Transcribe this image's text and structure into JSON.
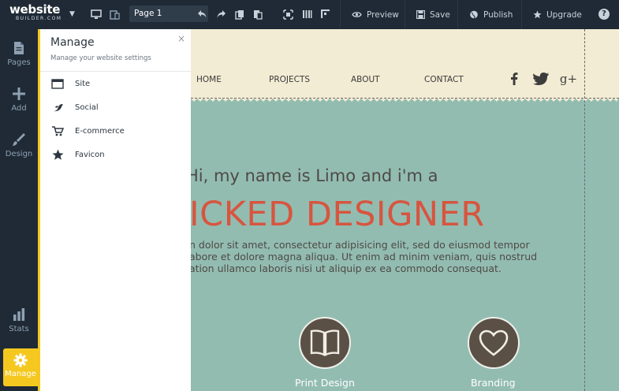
{
  "topbar": {
    "logo_main": "website",
    "logo_sub": "BUILDER.COM",
    "page_select": "Page 1",
    "preview_label": "Preview",
    "save_label": "Save",
    "publish_label": "Publish",
    "upgrade_label": "Upgrade",
    "help_label": "?"
  },
  "sidebar": {
    "items": [
      {
        "label": "Pages",
        "icon": "pages-icon"
      },
      {
        "label": "Add",
        "icon": "plus-icon"
      },
      {
        "label": "Design",
        "icon": "brush-icon"
      },
      {
        "label": "Stats",
        "icon": "stats-icon"
      }
    ],
    "active": {
      "label": "Manage",
      "icon": "gear-icon"
    },
    "accent_color": "#f5c81f"
  },
  "panel": {
    "title": "Manage",
    "subtitle": "Manage your website settings",
    "close": "×",
    "items": [
      {
        "label": "Site",
        "icon": "window-icon"
      },
      {
        "label": "Social",
        "icon": "bird-icon"
      },
      {
        "label": "E-commerce",
        "icon": "cart-icon"
      },
      {
        "label": "Favicon",
        "icon": "star-icon"
      }
    ]
  },
  "site": {
    "nav": [
      "HOME",
      "PROJECTS",
      "ABOUT",
      "CONTACT"
    ],
    "social": [
      {
        "label": "f",
        "icon": "facebook-icon"
      },
      {
        "label": "",
        "icon": "twitter-icon"
      },
      {
        "label": "g+",
        "icon": "google-plus-icon"
      }
    ],
    "hero_intro": "Hi, my name is Limo and i'm a",
    "hero_title": "ICKED DESIGNER",
    "hero_body": [
      "n dolor sit amet, consectetur adipisicing elit, sed do eiusmod tempor",
      "abore et dolore magna aliqua. Ut enim ad minim veniam, quis nostrud",
      "ation ullamco laboris nisi ut aliquip ex ea commodo consequat."
    ],
    "features": [
      {
        "label": "Print Design",
        "icon": "book-icon"
      },
      {
        "label": "Branding",
        "icon": "heart-icon"
      }
    ],
    "colors": {
      "header_bg": "#f3ecd4",
      "body_bg": "#93bcb1",
      "title_red": "#d7553f",
      "feature_circle": "#5b5046"
    }
  }
}
